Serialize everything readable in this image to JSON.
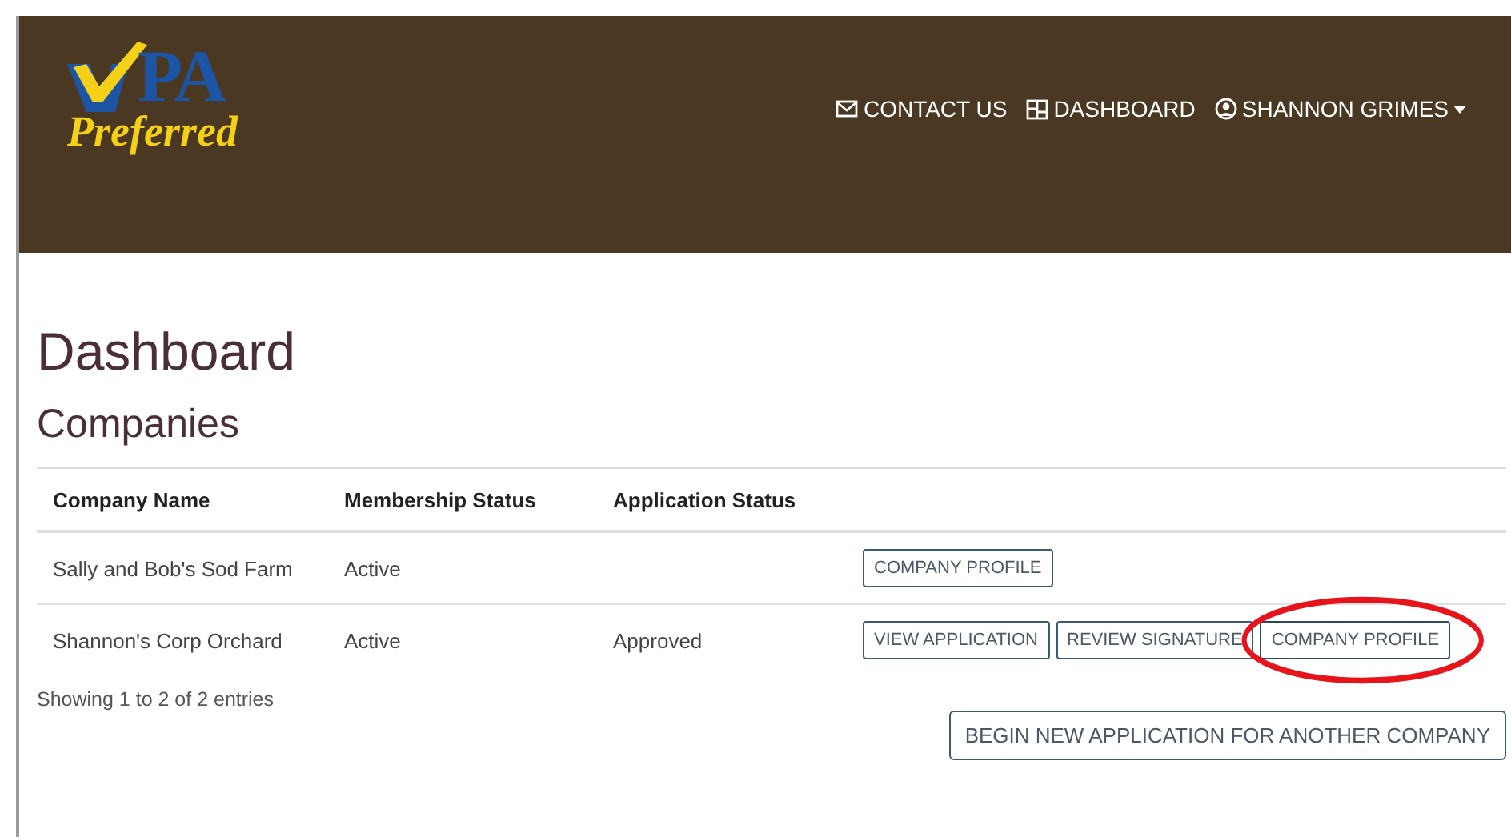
{
  "logo": {
    "mark": "PA",
    "word": "Preferred"
  },
  "nav": [
    {
      "kind": "mail",
      "label": "CONTACT US"
    },
    {
      "kind": "dashboard",
      "label": "DASHBOARD"
    },
    {
      "kind": "user",
      "label": "SHANNON GRIMES",
      "dropdown": true
    }
  ],
  "page_title": "Dashboard",
  "section_title": "Companies",
  "table": {
    "columns": [
      "Company Name",
      "Membership Status",
      "Application Status"
    ],
    "rows": [
      {
        "cells": [
          "Sally and Bob's Sod Farm",
          "Active",
          ""
        ],
        "actions": [
          {
            "label": "COMPANY PROFILE",
            "highlighted": false
          }
        ]
      },
      {
        "cells": [
          "Shannon's Corp Orchard",
          "Active",
          "Approved"
        ],
        "actions": [
          {
            "label": "VIEW APPLICATION",
            "highlighted": false
          },
          {
            "label": "REVIEW SIGNATURE",
            "highlighted": false
          },
          {
            "label": "COMPANY PROFILE",
            "highlighted": true
          }
        ]
      }
    ]
  },
  "table_info": "Showing 1 to 2 of 2 entries",
  "new_application_button": "BEGIN NEW APPLICATION FOR ANOTHER COMPANY"
}
